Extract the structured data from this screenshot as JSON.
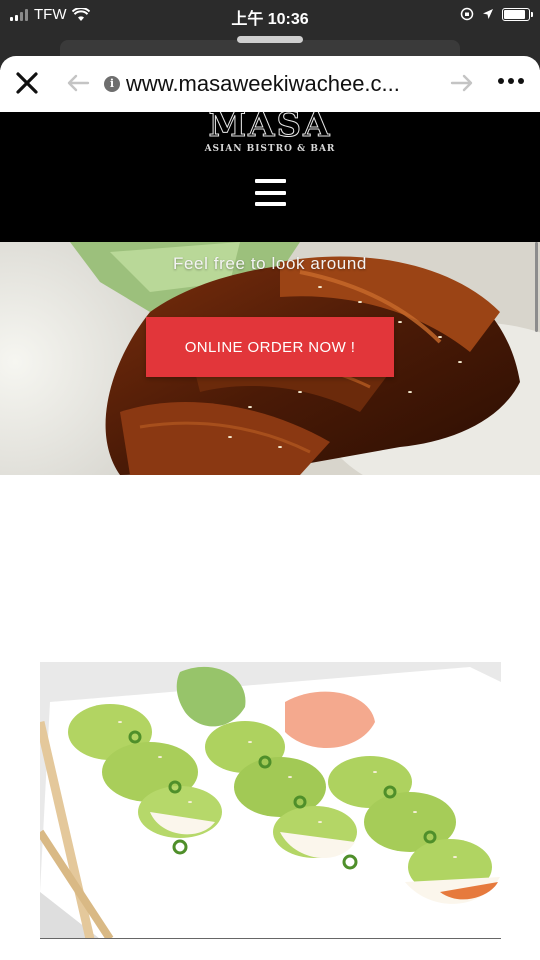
{
  "status_bar": {
    "carrier": "TFW",
    "time": "上午 10:36"
  },
  "browser": {
    "url": "www.masaweekiwachee.c...",
    "close_icon": "close-icon",
    "back_icon": "arrow-left-icon",
    "forward_icon": "arrow-right-icon",
    "info_icon": "info-icon",
    "info_glyph": "i",
    "more_icon": "more-dots-icon"
  },
  "site": {
    "logo_text": "MASA",
    "logo_subtitle": "ASIAN BISTRO & BAR",
    "menu_icon": "hamburger-menu-icon",
    "hero_tagline": "Feel free to look around",
    "order_button": "ONLINE ORDER NOW !"
  },
  "colors": {
    "header_bg": "#000000",
    "order_button": "#e2363a",
    "status_bar_bg": "#2b2b2b"
  }
}
